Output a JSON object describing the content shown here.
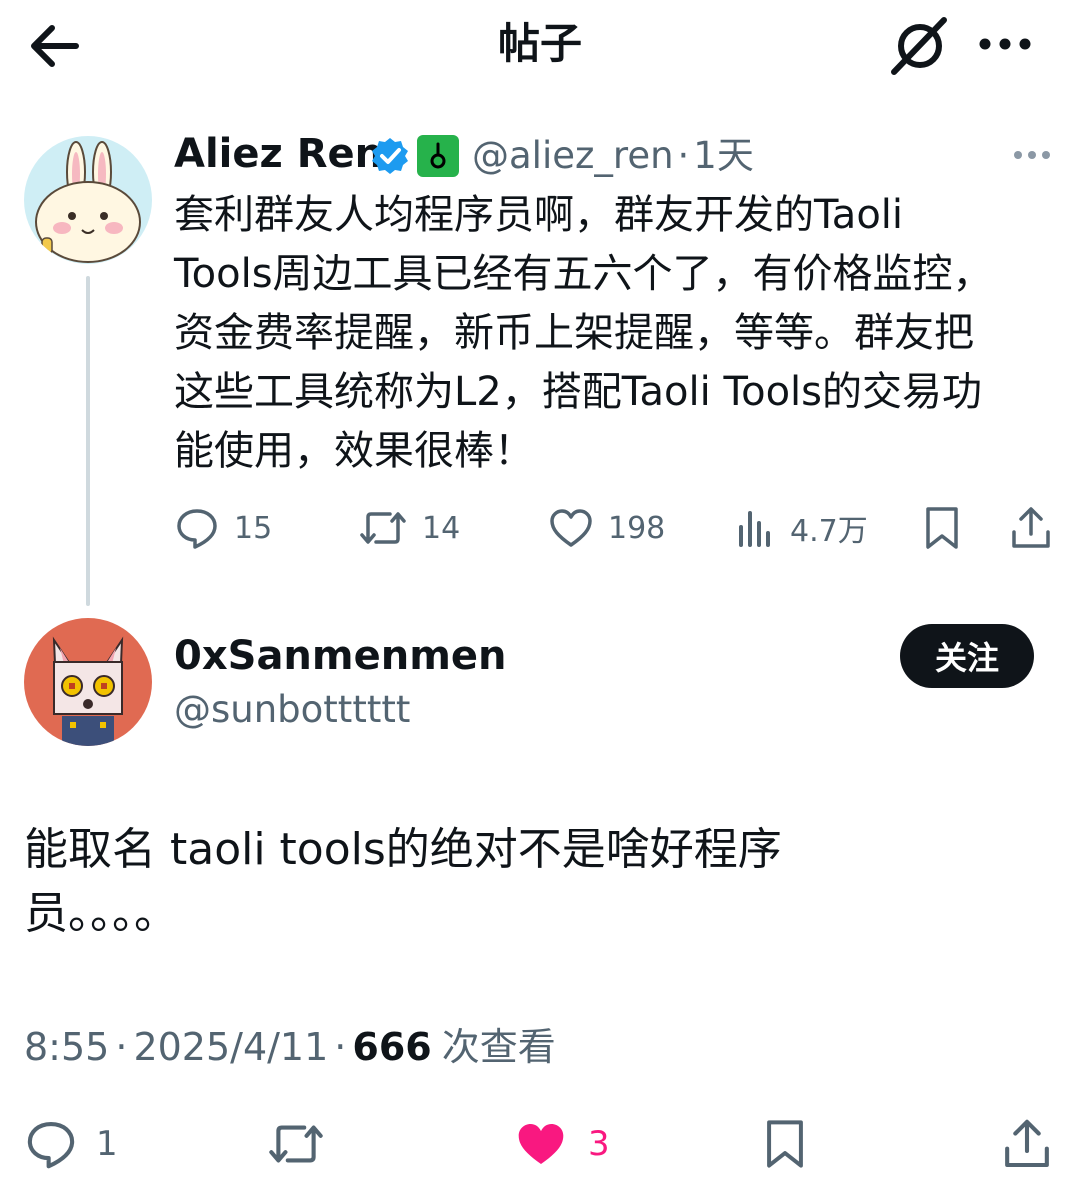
{
  "header": {
    "title": "帖子",
    "back_icon": "arrow-left-icon",
    "grok_icon": "grok-slash-icon",
    "more_icon": "more-horizontal-icon"
  },
  "parent_tweet": {
    "author_name": "Aliez Ren",
    "handle": "@aliez_ren",
    "separator": "·",
    "age": "1天",
    "verified_color": "#1d9bf0",
    "badge_color": "#26b24b",
    "text": "套利群友人均程序员啊，群友开发的Taoli\nTools周边工具已经有五六个了，有价格监控，\n资金费率提醒，新币上架提醒，等等。群友把\n这些工具统称为L2，搭配Taoli Tools的交易功\n能使用，效果很棒！",
    "actions": {
      "replies": "15",
      "retweets": "14",
      "likes": "198",
      "views": "4.7万"
    }
  },
  "reply": {
    "author_name": "0xSanmenmen",
    "handle": "@sunbotttttt",
    "follow_label": "关注",
    "text": "能取名 taoli  tools的绝对不是啥好程序\n员。。。。",
    "time": "8:55",
    "sep1": "·",
    "date": "2025/4/11",
    "sep2": "·",
    "view_count": "666",
    "view_label": "次查看",
    "actions": {
      "replies": "1",
      "likes": "3",
      "like_color": "#f91880"
    }
  }
}
